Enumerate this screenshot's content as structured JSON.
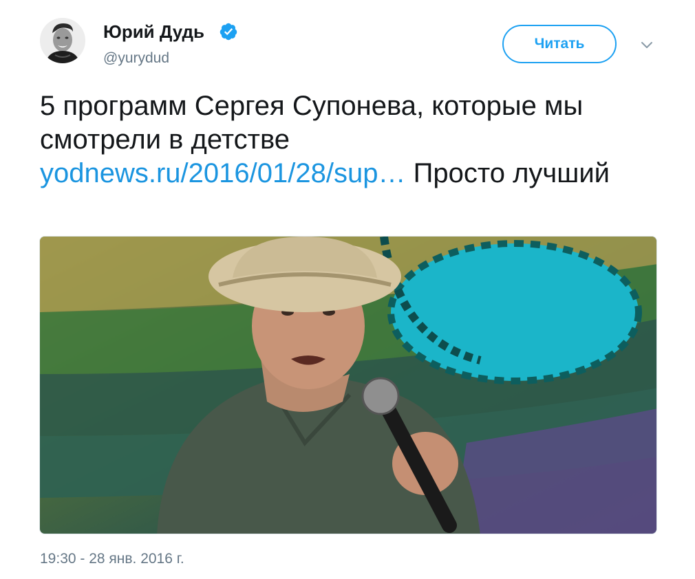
{
  "author": {
    "name": "Юрий Дудь",
    "handle": "@yurydud",
    "verified": true,
    "avatar_icon": "profile-photo"
  },
  "follow_button": {
    "label": "Читать"
  },
  "menu": {
    "icon": "chevron-down-icon"
  },
  "tweet": {
    "text_before_link": "5 программ Сергея Супонева, которые мы смотрели в детстве",
    "link_text": "yodnews.ru/2016/01/28/sup…",
    "text_after_link": "Просто лучший"
  },
  "media": {
    "type": "photo"
  },
  "timestamp": "19:30 - 28 янв. 2016 г.",
  "colors": {
    "accent": "#1da1f2",
    "link": "#1b95e0",
    "secondary_text": "#657786",
    "text": "#14171a"
  }
}
